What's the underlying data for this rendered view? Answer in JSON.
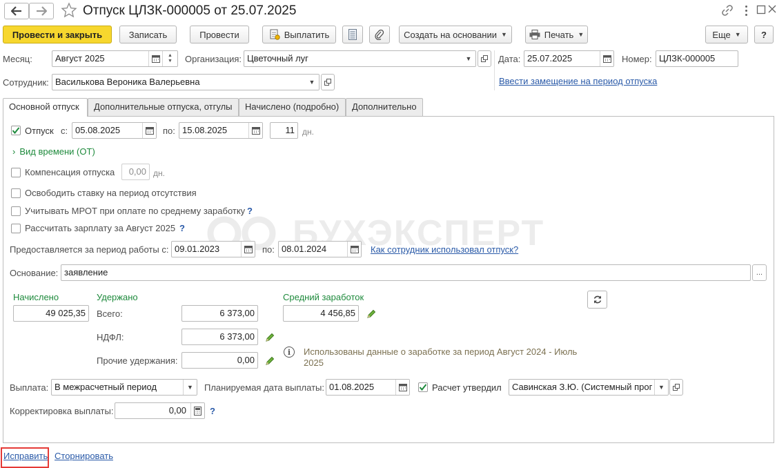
{
  "window": {
    "title": "Отпуск ЦЛЗК-000005 от 25.07.2025"
  },
  "toolbar": {
    "post_and_close": "Провести и закрыть",
    "save": "Записать",
    "post": "Провести",
    "pay": "Выплатить",
    "create_based_on": "Создать на основании",
    "print": "Печать",
    "more": "Еще",
    "help": "?"
  },
  "header": {
    "month_label": "Месяц:",
    "month_value": "Август 2025",
    "org_label": "Организация:",
    "org_value": "Цветочный луг",
    "date_label": "Дата:",
    "date_value": "25.07.2025",
    "number_label": "Номер:",
    "number_value": "ЦЛЗК-000005",
    "employee_label": "Сотрудник:",
    "employee_value": "Василькова Вероника Валерьевна",
    "substitute_link": "Ввести замещение на период отпуска"
  },
  "tabs": [
    {
      "label": "Основной отпуск"
    },
    {
      "label": "Дополнительные отпуска, отгулы"
    },
    {
      "label": "Начислено (подробно)"
    },
    {
      "label": "Дополнительно"
    }
  ],
  "main": {
    "vacation_label": "Отпуск",
    "from_label": "с:",
    "from_value": "05.08.2025",
    "to_label": "по:",
    "to_value": "15.08.2025",
    "days_value": "11",
    "days_unit": "дн.",
    "time_type": "Вид времени (ОТ)",
    "compensation_label": "Компенсация отпуска",
    "compensation_value": "0,00",
    "compensation_unit": "дн.",
    "free_rate": "Освободить ставку на период отсутствия",
    "mrot": "Учитывать МРОТ при оплате по среднему заработку",
    "calc_salary": "Рассчитать зарплату за Август 2025",
    "period_label": "Предоставляется за период работы с:",
    "period_from": "09.01.2023",
    "period_to_label": "по:",
    "period_to": "08.01.2024",
    "used_link": "Как сотрудник использовал отпуск?",
    "basis_label": "Основание:",
    "basis_value": "заявление",
    "basis_btn": "...",
    "accrued_label": "Начислено",
    "accrued_value": "49 025,35",
    "withheld_label": "Удержано",
    "total_label": "Всего:",
    "total_value": "6 373,00",
    "ndfl_label": "НДФЛ:",
    "ndfl_value": "6 373,00",
    "other_label": "Прочие удержания:",
    "other_value": "0,00",
    "avg_label": "Средний заработок",
    "avg_value": "4 456,85",
    "info_text": "Использованы данные о заработке за период Август 2024 - Июль 2025",
    "payout_label": "Выплата:",
    "payout_value": "В межрасчетный период",
    "planned_date_label": "Планируемая дата выплаты:",
    "planned_date_value": "01.08.2025",
    "approved_label": "Расчет утвердил",
    "approved_value": "Савинская З.Ю. (Системный прог",
    "correction_label": "Корректировка выплаты:",
    "correction_value": "0,00"
  },
  "footer": {
    "fix_link": "Исправить",
    "storno_link": "Сторнировать"
  },
  "watermark": "БУХЭКСПЕРТ",
  "colors": {
    "primary_button": "#f7d72e",
    "link": "#2a5aa8",
    "green_label": "#1e8a3c",
    "highlight_box": "#e53935"
  }
}
